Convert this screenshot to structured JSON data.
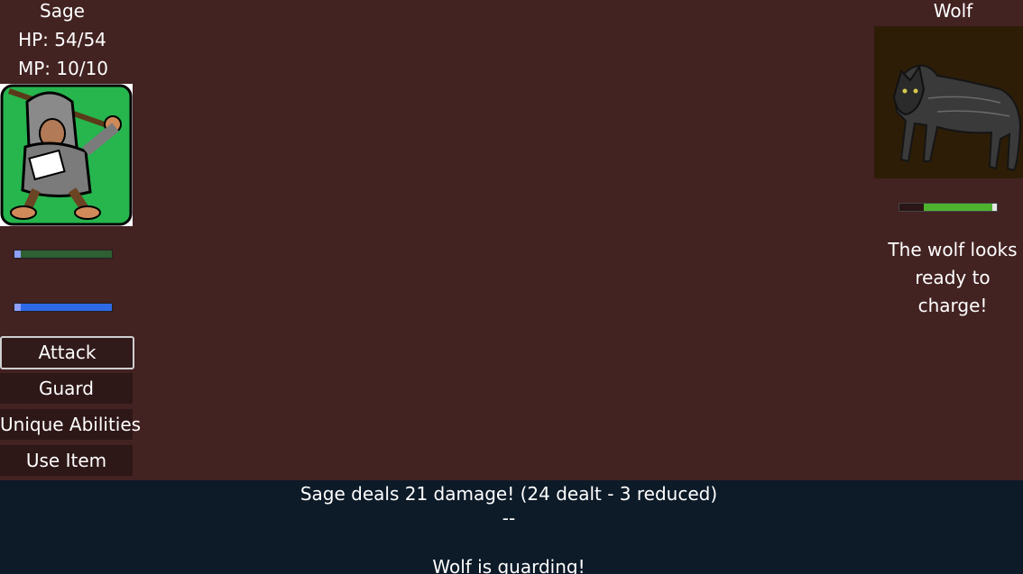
{
  "player": {
    "name": "Sage",
    "hp_text": "HP: 54/54",
    "mp_text": "MP: 10/10",
    "hp_fraction": 1.0,
    "mp_fraction": 1.0,
    "portrait_icon": "hooded-sage-portrait"
  },
  "menu": {
    "attack": "Attack",
    "guard": "Guard",
    "unique": "Unique Abilities",
    "item": "Use Item"
  },
  "enemy": {
    "name": "Wolf",
    "hp_fraction": 0.75,
    "status": "The wolf looks ready to charge!",
    "portrait_icon": "wolf-portrait"
  },
  "log": {
    "line1": "Sage deals 21 damage! (24 dealt - 3 reduced)",
    "line2": "--",
    "line3": "Wolf is guarding!"
  },
  "colors": {
    "background": "#432222",
    "log_background": "#0d1a28",
    "hp_bar": "#4db32f",
    "mp_bar": "#2f6ae6"
  }
}
